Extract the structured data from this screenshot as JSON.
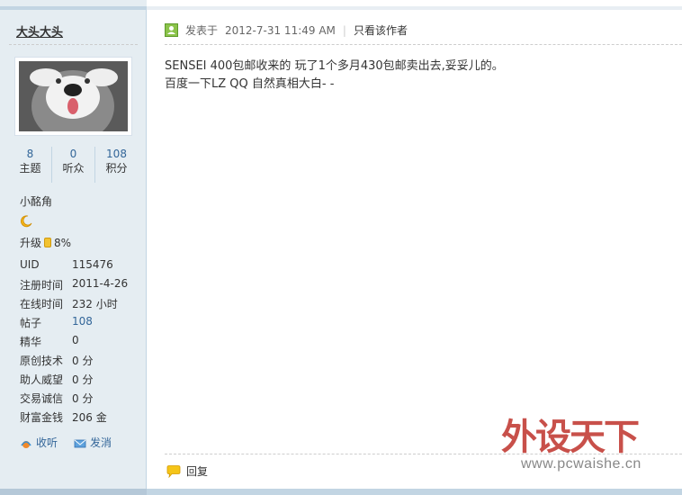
{
  "author": {
    "name": "大头大头",
    "stats": [
      {
        "value": "8",
        "label": "主题"
      },
      {
        "value": "0",
        "label": "听众"
      },
      {
        "value": "108",
        "label": "积分"
      }
    ],
    "usergroup": "小酩角",
    "level_label": "升级",
    "level_progress": "8%",
    "profile": [
      {
        "key": "UID",
        "value": "115476"
      },
      {
        "key": "注册时间",
        "value": "2011-4-26"
      },
      {
        "key": "在线时间",
        "value": "232 小时"
      },
      {
        "key": "帖子",
        "value": "108"
      },
      {
        "key": "精华",
        "value": "0"
      },
      {
        "key": "原创技术",
        "value": "0 分"
      },
      {
        "key": "助人威望",
        "value": "0 分"
      },
      {
        "key": "交易诚信",
        "value": "0 分"
      },
      {
        "key": "财富金钱",
        "value": "206 金"
      }
    ],
    "actions": {
      "follow": "收听",
      "message": "发消"
    }
  },
  "post": {
    "posted_label": "发表于",
    "timestamp": "2012-7-31 11:49 AM",
    "separator": "|",
    "author_only": "只看该作者",
    "lines": [
      "SENSEI 400包邮收来的  玩了1个多月430包邮卖出去,妥妥儿的。",
      "百度一下LZ QQ 自然真相大白- -"
    ],
    "reply_label": "回复"
  },
  "watermark": {
    "chars": [
      "外",
      "设",
      "天",
      "下"
    ],
    "url": "www.pcwaishe.cn"
  },
  "colors": {
    "sidebar_bg": "#e5edf2",
    "link": "#336699",
    "watermark_red": "#c8504a"
  }
}
